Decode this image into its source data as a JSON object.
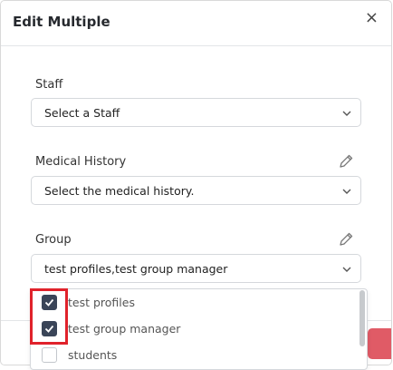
{
  "modal": {
    "title": "Edit Multiple",
    "close_glyph": "×"
  },
  "fields": {
    "staff": {
      "label": "Staff",
      "value": "Select a Staff"
    },
    "medical_history": {
      "label": "Medical History",
      "value": "Select the medical history."
    },
    "group": {
      "label": "Group",
      "value": "test profiles,test group manager"
    }
  },
  "group_options": [
    {
      "label": "test profiles",
      "checked": true
    },
    {
      "label": "test group manager",
      "checked": true
    },
    {
      "label": "students",
      "checked": false
    }
  ],
  "colors": {
    "checkbox_checked": "#3a4558",
    "highlight_box": "#e0222b",
    "footer_button": "#e05b66"
  },
  "icons": [
    "close-icon",
    "chevron-down-icon",
    "pencil-icon",
    "checkmark-icon"
  ]
}
